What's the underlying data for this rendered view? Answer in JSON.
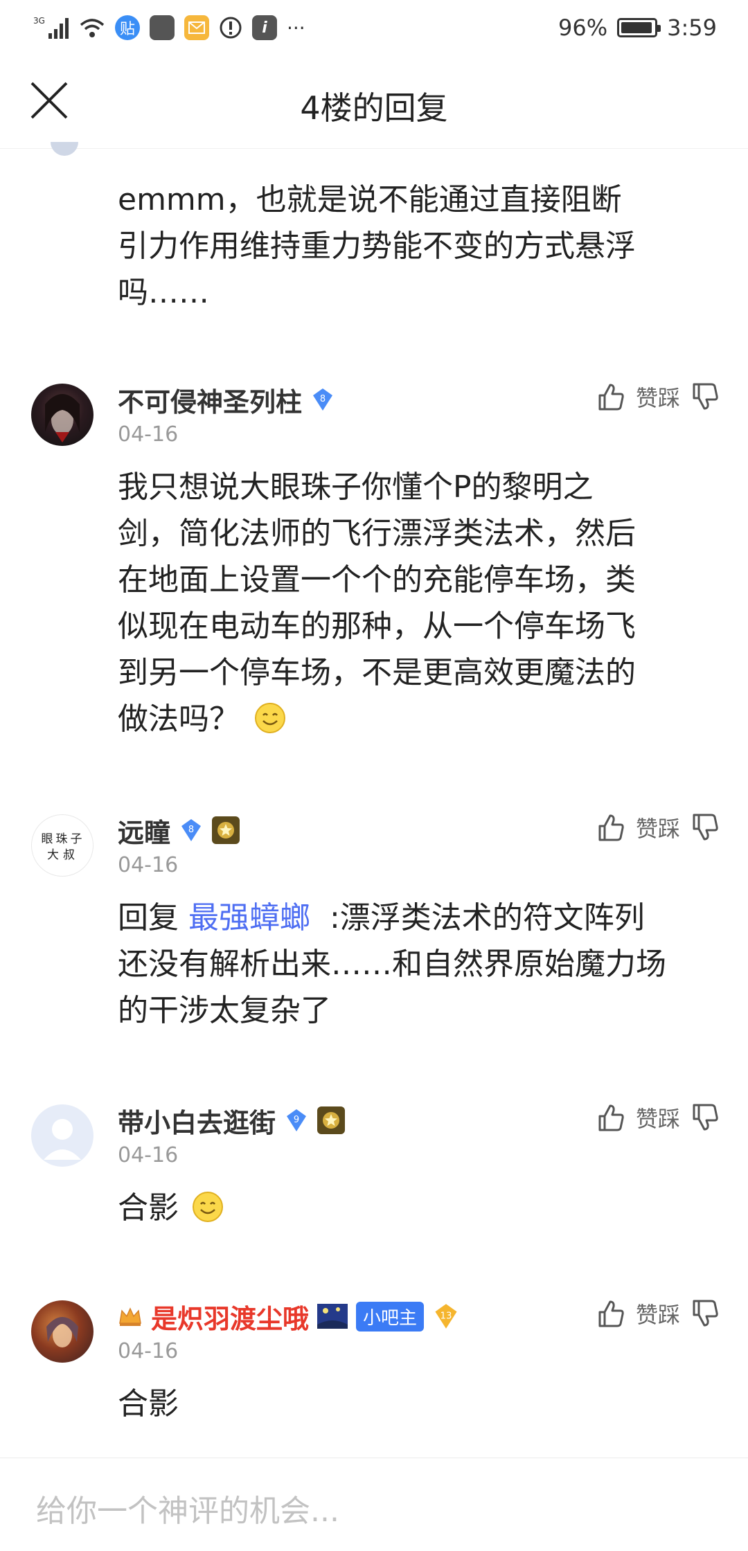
{
  "status_bar": {
    "network": "3G",
    "battery_text": "96%",
    "battery_level": 0.96,
    "time": "3:59",
    "notif_tieba_icon": "贴",
    "more_icon": "···"
  },
  "header": {
    "title": "4楼的回复"
  },
  "top_comment": {
    "text_lines": [
      "emmm，也就是说不能通过直接阻断",
      "引力作用维持重力势能不变的方式悬浮",
      "吗……"
    ]
  },
  "comments": [
    {
      "username": "不可侵神圣列柱",
      "level": "8",
      "date": "04-16",
      "like_label": "赞",
      "dislike_label": "踩",
      "text_lines": [
        "我只想说大眼珠子你懂个P的黎明之",
        "剑，简化法师的飞行漂浮类法术，然后",
        "在地面上设置一个个的充能停车场，类",
        "似现在电动车的那种，从一个停车场飞",
        "到另一个停车场，不是更高效更魔法的",
        "做法吗？"
      ]
    },
    {
      "username": "远瞳",
      "level": "8",
      "avatar_text": [
        "眼珠子",
        "大叔"
      ],
      "date": "04-16",
      "like_label": "赞",
      "dislike_label": "踩",
      "reply_prefix": "回复",
      "reply_target": "最强蟑螂",
      "text_lines": [
        ":漂浮类法术的符文阵列",
        "还没有解析出来……和自然界原始魔力场",
        "的干涉太复杂了"
      ]
    },
    {
      "username": "带小白去逛街",
      "level": "9",
      "date": "04-16",
      "like_label": "赞",
      "dislike_label": "踩",
      "text": "合影"
    },
    {
      "username": "是炽羽渡尘哦",
      "level": "13",
      "role_badge": "小吧主",
      "date": "04-16",
      "like_label": "赞",
      "dislike_label": "踩",
      "text": "合影"
    }
  ],
  "bottom": {
    "placeholder": "给你一个神评的机会..."
  },
  "colors": {
    "link": "#4e6ef2",
    "level_badge": "#4a8cf7",
    "vip_name": "#e8382a",
    "xbz_badge": "#3b7bf5"
  }
}
